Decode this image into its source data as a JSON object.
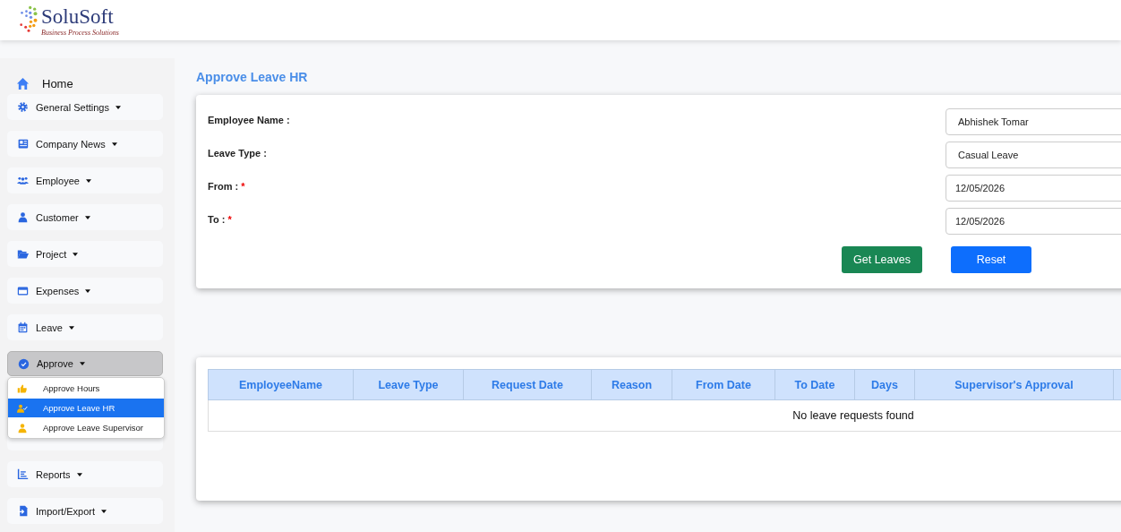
{
  "brand": {
    "name": "SoluSoft",
    "tagline": "Business Process Solutions"
  },
  "sidebar": {
    "home": {
      "label": "Home"
    },
    "items": [
      {
        "label": "General Settings",
        "expanded": false
      },
      {
        "label": "Company News",
        "expanded": false
      },
      {
        "label": "Employee",
        "expanded": false
      },
      {
        "label": "Customer",
        "expanded": false
      },
      {
        "label": "Project",
        "expanded": false
      },
      {
        "label": "Expenses",
        "expanded": false
      },
      {
        "label": "Leave",
        "expanded": false
      },
      {
        "label": "Approve",
        "expanded": true,
        "children": [
          {
            "label": "Approve Hours",
            "selected": false
          },
          {
            "label": "Approve Leave HR",
            "selected": true
          },
          {
            "label": "Approve Leave Supervisor",
            "selected": false
          }
        ]
      },
      {
        "label": "Reports",
        "expanded": false
      },
      {
        "label": "Import/Export",
        "expanded": false
      }
    ]
  },
  "page_title": "Approve Leave HR",
  "form": {
    "fields": [
      {
        "label": "Employee Name :",
        "value": "Abhishek Tomar"
      },
      {
        "label": "Leave Type :",
        "value": "Casual Leave"
      },
      {
        "label": "From :",
        "required_mark": "*",
        "value": "12/05/2026"
      },
      {
        "label": "To :",
        "required_mark": "*",
        "value": "12/05/2026"
      }
    ],
    "buttons": [
      {
        "label": "Get Leaves",
        "kind": "success"
      },
      {
        "label": "Reset",
        "kind": "primary"
      }
    ]
  },
  "table": {
    "columns": [
      "EmployeeName",
      "Leave Type",
      "Request Date",
      "Reason",
      "From Date",
      "To Date",
      "Days",
      "Supervisor's Approval"
    ],
    "empty_message": "No leave requests found"
  }
}
